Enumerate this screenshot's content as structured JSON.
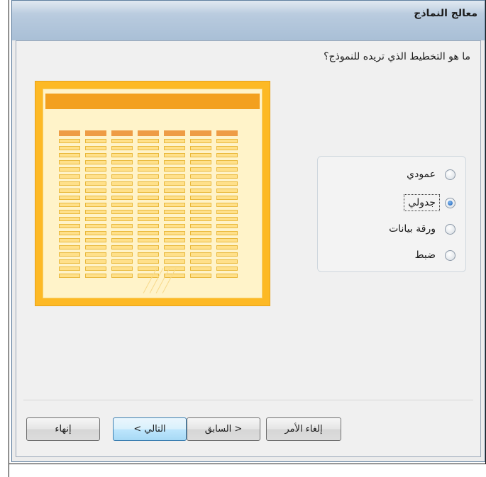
{
  "window": {
    "title": "معالج النماذج"
  },
  "question": "ما هو التخطيط الذي تريده للنموذج؟",
  "options": [
    {
      "label": "عمودي",
      "checked": false
    },
    {
      "label": "جدولي",
      "checked": true
    },
    {
      "label": "ورقة بيانات",
      "checked": false
    },
    {
      "label": "ضبط",
      "checked": false
    }
  ],
  "buttons": {
    "cancel": "إلغاء الأمر",
    "back": "< السابق",
    "next": "التالي >",
    "finish": "إنهاء"
  },
  "colors": {
    "preview_border": "#fdb925",
    "preview_header": "#f3a01f",
    "column_header": "#ee9c45",
    "cell": "#ffe08a"
  }
}
